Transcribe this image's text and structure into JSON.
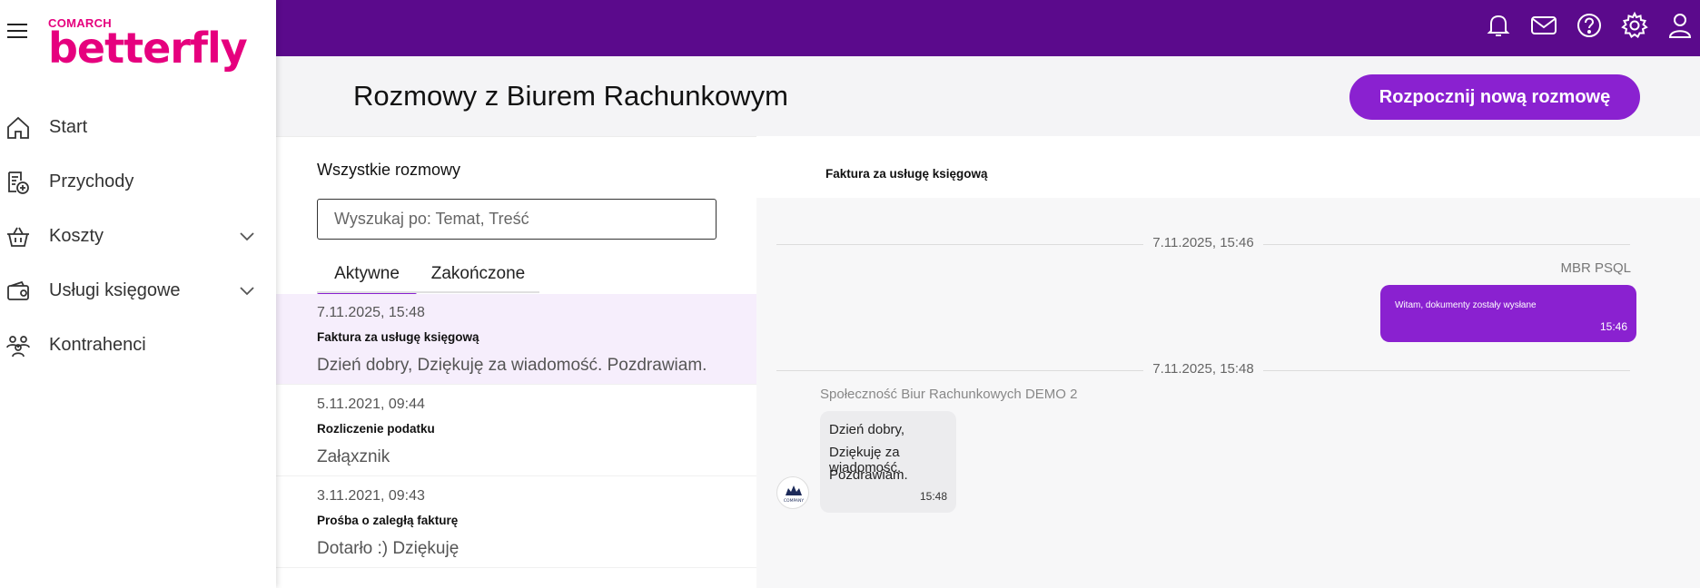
{
  "brand": {
    "company": "COMARCH",
    "product": "betterfly"
  },
  "sidebar": {
    "items": [
      {
        "label": "Start",
        "icon": "home-icon"
      },
      {
        "label": "Przychody",
        "icon": "income-document-icon"
      },
      {
        "label": "Koszty",
        "icon": "basket-icon"
      },
      {
        "label": "Usługi księgowe",
        "icon": "wallet-icon"
      },
      {
        "label": "Kontrahenci",
        "icon": "contacts-icon"
      }
    ]
  },
  "topbar": {
    "icons": [
      "bell-icon",
      "mail-icon",
      "help-icon",
      "gear-icon",
      "user-icon"
    ]
  },
  "page": {
    "title": "Rozmowy z Biurem Rachunkowym",
    "new_button": "Rozpocznij nową rozmowę"
  },
  "list": {
    "heading": "Wszystkie rozmowy",
    "search_placeholder": "Wyszukaj po: Temat, Treść",
    "tabs": [
      {
        "label": "Aktywne",
        "active": true
      },
      {
        "label": "Zakończone",
        "active": false
      }
    ],
    "conversations": [
      {
        "date": "7.11.2025, 15:48",
        "subject": "Faktura za usługę księgową",
        "preview": "Dzień dobry, Dziękuję za wiadomość. Pozdrawiam."
      },
      {
        "date": "5.11.2021, 09:44",
        "subject": "Rozliczenie podatku",
        "preview": "Załąxznik"
      },
      {
        "date": "3.11.2021, 09:43",
        "subject": "Prośba o zaległą fakturę",
        "preview": "Dotarło :) Dziękuję"
      }
    ]
  },
  "chat": {
    "subject": "Faktura za usługę księgową",
    "separators": [
      "7.11.2025, 15:46",
      "7.11.2025, 15:48"
    ],
    "outgoing": {
      "sender": "MBR PSQL",
      "text": "Witam, dokumenty zostały wysłane",
      "time": "15:46"
    },
    "incoming": {
      "sender": "Społeczność Biur Rachunkowych DEMO 2",
      "lines": [
        "Dzień dobry,",
        "Dziękuję za wiadomość.",
        "Pozdrawiam."
      ],
      "time": "15:48",
      "avatar_label": "COMPANY"
    }
  },
  "colors": {
    "topbar": "#5b0a8c",
    "accent": "#8a21d0",
    "brand": "#e6007e",
    "selected_row": "#f6eefc"
  }
}
